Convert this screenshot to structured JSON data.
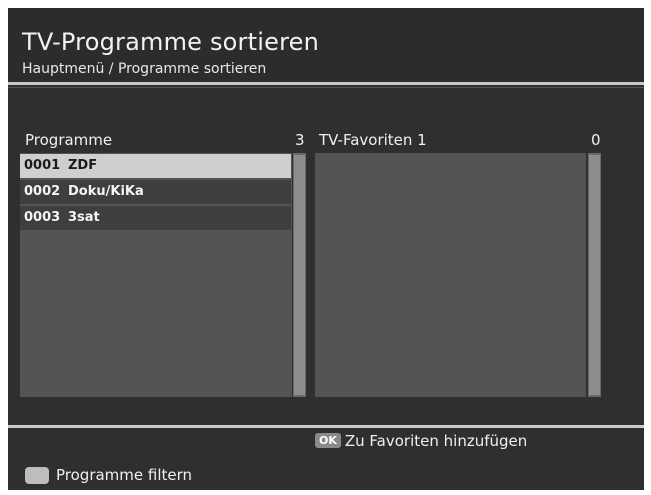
{
  "header": {
    "title": "TV-Programme sortieren",
    "breadcrumb": "Hauptmenü / Programme sortieren"
  },
  "left_panel": {
    "label": "Programme",
    "count": "3",
    "rows": [
      {
        "number": "0001",
        "name": "ZDF",
        "selected": true
      },
      {
        "number": "0002",
        "name": "Doku/KiKa",
        "selected": false
      },
      {
        "number": "0003",
        "name": "3sat",
        "selected": false
      }
    ]
  },
  "right_panel": {
    "label": "TV-Favoriten 1",
    "count": "0"
  },
  "footer": {
    "ok_badge": "OK",
    "ok_label": "Zu Favoriten hinzufügen",
    "filter_label": "Programme filtern"
  }
}
